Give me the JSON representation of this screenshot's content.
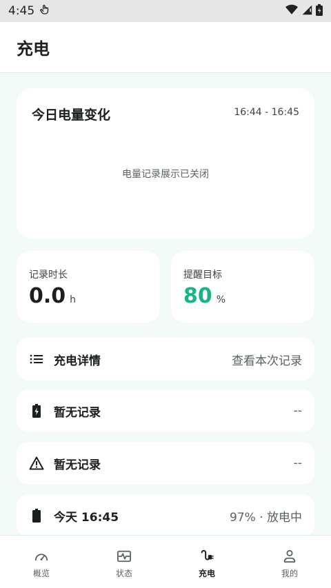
{
  "status_bar": {
    "time": "4:45"
  },
  "app_bar": {
    "title": "充电"
  },
  "chart_card": {
    "title": "今日电量变化",
    "time_range": "16:44 - 16:45",
    "empty_message": "电量记录展示已关闭"
  },
  "stats": {
    "duration": {
      "label": "记录时长",
      "value": "0.0",
      "unit": "h"
    },
    "target": {
      "label": "提醒目标",
      "value": "80",
      "unit": "%"
    }
  },
  "rows": [
    {
      "label": "充电详情",
      "value": "查看本次记录",
      "icon": "list-icon"
    },
    {
      "label": "暂无记录",
      "value": "--",
      "icon": "battery-charging-icon"
    },
    {
      "label": "暂无记录",
      "value": "--",
      "icon": "warning-icon"
    },
    {
      "label": "今天 16:45",
      "value": "97% · 放电中",
      "icon": "battery-icon"
    }
  ],
  "bottom_nav": [
    {
      "label": "概览",
      "icon": "speedometer-icon"
    },
    {
      "label": "状态",
      "icon": "pulse-icon"
    },
    {
      "label": "充电",
      "icon": "plug-icon",
      "active": true
    },
    {
      "label": "我的",
      "icon": "person-icon"
    }
  ],
  "colors": {
    "accent": "#17b48a",
    "background": "#f2fbf8"
  }
}
